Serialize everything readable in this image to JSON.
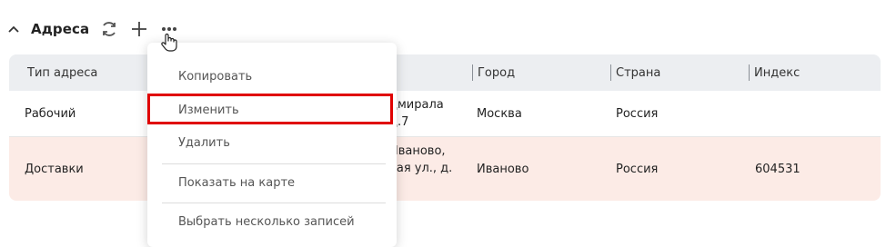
{
  "section": {
    "title": "Адреса"
  },
  "table": {
    "columns": [
      "Тип адреса",
      "Город",
      "Страна",
      "Индекс"
    ],
    "rows": [
      {
        "type": "Рабочий",
        "address_line1": "дмирала",
        "address_line2": "д.7",
        "city": "Москва",
        "country": "Россия",
        "index": ""
      },
      {
        "type": "Доставки",
        "address_line1": "Иваново,",
        "address_line2": "кая ул., д.",
        "city": "Иваново",
        "country": "Россия",
        "index": "604531"
      }
    ]
  },
  "context_menu": {
    "items": [
      "Копировать",
      "Изменить",
      "Удалить",
      "Показать на карте",
      "Выбрать несколько записей"
    ]
  },
  "colors": {
    "accent_highlight": "#e00000",
    "row_highlight": "#fcebe6",
    "header_bg": "#eceef1"
  },
  "icons": [
    "chevron-up-icon",
    "refresh-icon",
    "plus-icon",
    "more-icon",
    "hand-cursor-icon"
  ]
}
